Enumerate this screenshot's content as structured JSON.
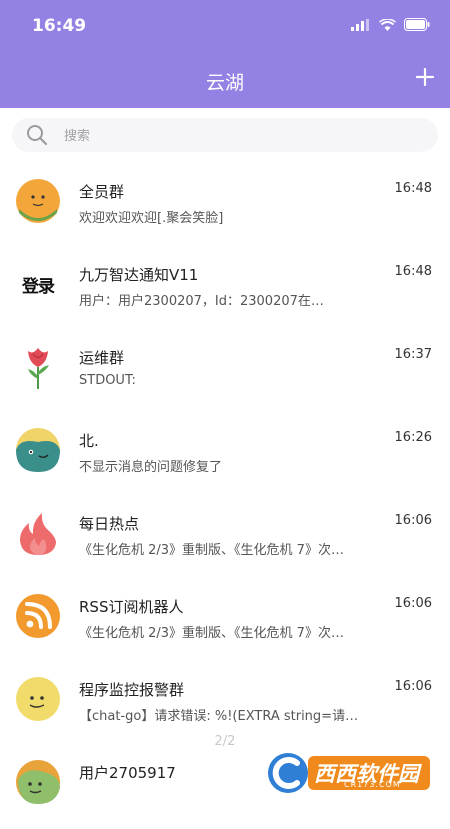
{
  "status": {
    "time": "16:49"
  },
  "header": {
    "title": "云湖",
    "add_icon": "plus-icon"
  },
  "search": {
    "placeholder": "搜索"
  },
  "chats": [
    {
      "name": "全员群",
      "time": "16:48",
      "preview": "欢迎欢迎欢迎[.聚会笑脸]",
      "avatar": "orange-smiley-face"
    },
    {
      "name": "九万智达通知V11",
      "time": "16:48",
      "preview": "用户：用户2300207，Id：2300207在…",
      "avatar": "login-glyph",
      "avatar_text": "登录"
    },
    {
      "name": "运维群",
      "time": "16:37",
      "preview": "STDOUT:",
      "avatar": "rose-flower"
    },
    {
      "name": "北.",
      "time": "16:26",
      "preview": "不显示消息的问题修复了",
      "avatar": "teal-yellow-face"
    },
    {
      "name": "每日热点",
      "time": "16:06",
      "preview": "《生化危机 2/3》重制版、《生化危机 7》次…",
      "avatar": "red-flame"
    },
    {
      "name": "RSS订阅机器人",
      "time": "16:06",
      "preview": "《生化危机 2/3》重制版、《生化危机 7》次…",
      "avatar": "orange-rss"
    },
    {
      "name": "程序监控报警群",
      "time": "16:06",
      "preview": "【chat-go】请求错误: %!(EXTRA string=请…",
      "avatar": "yellow-face"
    },
    {
      "name": "用户2705917",
      "time": "",
      "preview": "",
      "avatar": "green-face"
    }
  ],
  "page_indicator": "2/2",
  "watermark": {
    "text": "西西软件园",
    "sub": "CR173.COM"
  },
  "colors": {
    "header": "#9580e4"
  }
}
